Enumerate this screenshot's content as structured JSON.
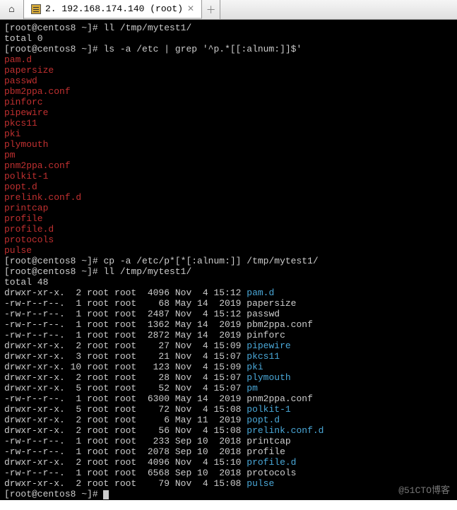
{
  "tabs": {
    "active_title": "2. 192.168.174.140 (root)"
  },
  "term": {
    "prompt1": "[root@centos8 ~]# ",
    "cmd1": "ll /tmp/mytest1/",
    "total0": "total 0",
    "prompt2": "[root@centos8 ~]# ",
    "cmd2": "ls -a /etc | grep '^p.*[[:alnum:]]$'",
    "grep_out": [
      "pam.d",
      "papersize",
      "passwd",
      "pbm2ppa.conf",
      "pinforc",
      "pipewire",
      "pkcs11",
      "pki",
      "plymouth",
      "pm",
      "pnm2ppa.conf",
      "polkit-1",
      "popt.d",
      "prelink.conf.d",
      "printcap",
      "profile",
      "profile.d",
      "protocols",
      "pulse"
    ],
    "prompt3": "[root@centos8 ~]# ",
    "cmd3": "cp -a /etc/p*[*[:alnum:]] /tmp/mytest1/",
    "prompt4": "[root@centos8 ~]# ",
    "cmd4": "ll /tmp/mytest1/",
    "total48": "total 48",
    "ll": [
      {
        "perm": "drwxr-xr-x.",
        "ln": " 2",
        "own": "root root",
        "sz": " 4096",
        "date": "Nov  4 15:12",
        "name": "pam.d",
        "dir": true
      },
      {
        "perm": "-rw-r--r--.",
        "ln": " 1",
        "own": "root root",
        "sz": "   68",
        "date": "May 14  2019",
        "name": "papersize",
        "dir": false
      },
      {
        "perm": "-rw-r--r--.",
        "ln": " 1",
        "own": "root root",
        "sz": " 2487",
        "date": "Nov  4 15:12",
        "name": "passwd",
        "dir": false
      },
      {
        "perm": "-rw-r--r--.",
        "ln": " 1",
        "own": "root root",
        "sz": " 1362",
        "date": "May 14  2019",
        "name": "pbm2ppa.conf",
        "dir": false
      },
      {
        "perm": "-rw-r--r--.",
        "ln": " 1",
        "own": "root root",
        "sz": " 2872",
        "date": "May 14  2019",
        "name": "pinforc",
        "dir": false
      },
      {
        "perm": "drwxr-xr-x.",
        "ln": " 2",
        "own": "root root",
        "sz": "   27",
        "date": "Nov  4 15:09",
        "name": "pipewire",
        "dir": true
      },
      {
        "perm": "drwxr-xr-x.",
        "ln": " 3",
        "own": "root root",
        "sz": "   21",
        "date": "Nov  4 15:07",
        "name": "pkcs11",
        "dir": true
      },
      {
        "perm": "drwxr-xr-x.",
        "ln": "10",
        "own": "root root",
        "sz": "  123",
        "date": "Nov  4 15:09",
        "name": "pki",
        "dir": true
      },
      {
        "perm": "drwxr-xr-x.",
        "ln": " 2",
        "own": "root root",
        "sz": "   28",
        "date": "Nov  4 15:07",
        "name": "plymouth",
        "dir": true
      },
      {
        "perm": "drwxr-xr-x.",
        "ln": " 5",
        "own": "root root",
        "sz": "   52",
        "date": "Nov  4 15:07",
        "name": "pm",
        "dir": true
      },
      {
        "perm": "-rw-r--r--.",
        "ln": " 1",
        "own": "root root",
        "sz": " 6300",
        "date": "May 14  2019",
        "name": "pnm2ppa.conf",
        "dir": false
      },
      {
        "perm": "drwxr-xr-x.",
        "ln": " 5",
        "own": "root root",
        "sz": "   72",
        "date": "Nov  4 15:08",
        "name": "polkit-1",
        "dir": true
      },
      {
        "perm": "drwxr-xr-x.",
        "ln": " 2",
        "own": "root root",
        "sz": "    6",
        "date": "May 11  2019",
        "name": "popt.d",
        "dir": true
      },
      {
        "perm": "drwxr-xr-x.",
        "ln": " 2",
        "own": "root root",
        "sz": "   56",
        "date": "Nov  4 15:08",
        "name": "prelink.conf.d",
        "dir": true
      },
      {
        "perm": "-rw-r--r--.",
        "ln": " 1",
        "own": "root root",
        "sz": "  233",
        "date": "Sep 10  2018",
        "name": "printcap",
        "dir": false
      },
      {
        "perm": "-rw-r--r--.",
        "ln": " 1",
        "own": "root root",
        "sz": " 2078",
        "date": "Sep 10  2018",
        "name": "profile",
        "dir": false
      },
      {
        "perm": "drwxr-xr-x.",
        "ln": " 2",
        "own": "root root",
        "sz": " 4096",
        "date": "Nov  4 15:10",
        "name": "profile.d",
        "dir": true
      },
      {
        "perm": "-rw-r--r--.",
        "ln": " 1",
        "own": "root root",
        "sz": " 6568",
        "date": "Sep 10  2018",
        "name": "protocols",
        "dir": false
      },
      {
        "perm": "drwxr-xr-x.",
        "ln": " 2",
        "own": "root root",
        "sz": "   79",
        "date": "Nov  4 15:08",
        "name": "pulse",
        "dir": true
      }
    ],
    "prompt5": "[root@centos8 ~]# "
  },
  "watermark": "@51CTO博客"
}
